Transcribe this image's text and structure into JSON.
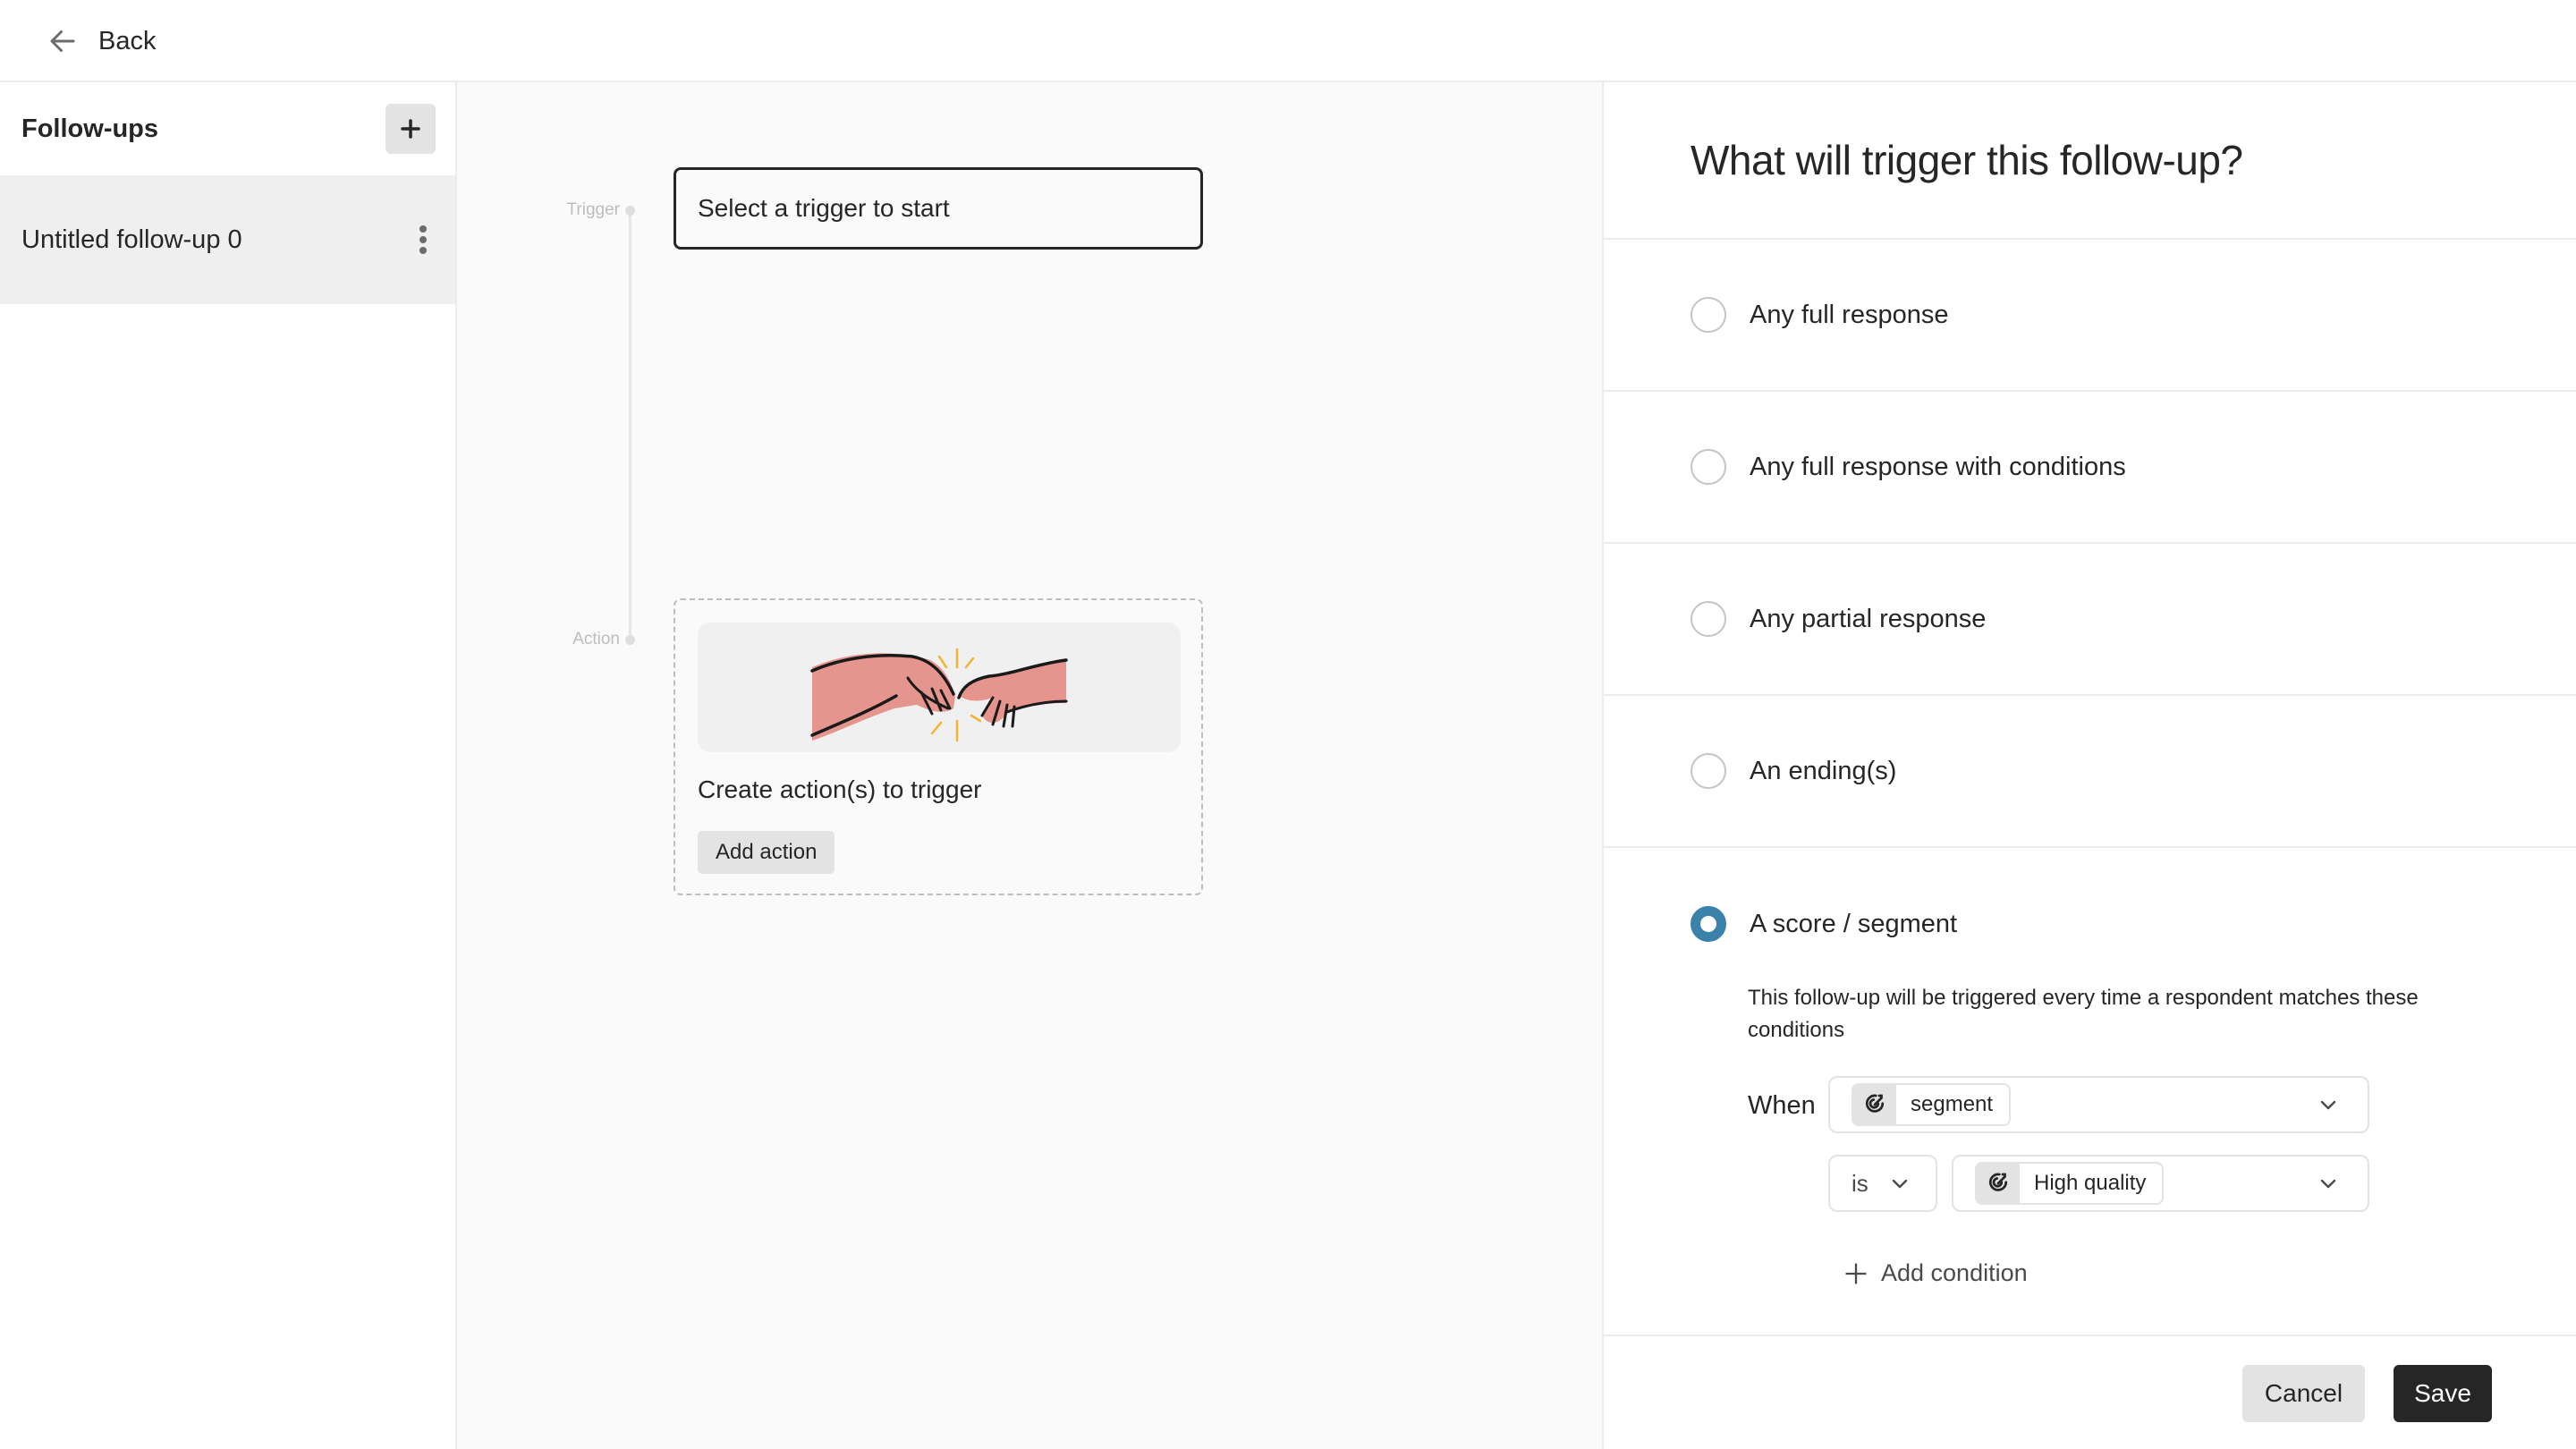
{
  "header": {
    "back_label": "Back",
    "back_icon": "arrow-left-icon"
  },
  "sidebar": {
    "title": "Follow-ups",
    "add_icon": "plus-icon",
    "items": [
      {
        "label": "Untitled follow-up 0",
        "selected": true,
        "menu_icon": "kebab-icon"
      }
    ]
  },
  "canvas": {
    "timeline": {
      "trigger_label": "Trigger",
      "action_label": "Action"
    },
    "trigger_box": {
      "placeholder": "Select a trigger to start"
    },
    "action_card": {
      "illustration": "hands-touching-illustration",
      "title": "Create action(s) to trigger",
      "button_label": "Add action"
    }
  },
  "panel": {
    "title": "What will trigger this follow-up?",
    "options": [
      {
        "label": "Any full response",
        "checked": false
      },
      {
        "label": "Any full response with conditions",
        "checked": false
      },
      {
        "label": "Any partial response",
        "checked": false
      },
      {
        "label": "An ending(s)",
        "checked": false
      },
      {
        "label": "A score / segment",
        "checked": true
      }
    ],
    "score_segment": {
      "description": "This follow-up will be triggered every time a respondent matches these conditions",
      "when_label": "When",
      "field_select": {
        "value": "segment",
        "icon": "segment-target-icon"
      },
      "operator_select": {
        "value": "is"
      },
      "value_select": {
        "value": "High quality",
        "icon": "segment-target-icon"
      },
      "add_condition_label": "Add condition"
    },
    "colors": {
      "radio_checked": "#3b82ab",
      "primary_button": "#262627"
    }
  },
  "footer": {
    "cancel_label": "Cancel",
    "save_label": "Save"
  }
}
